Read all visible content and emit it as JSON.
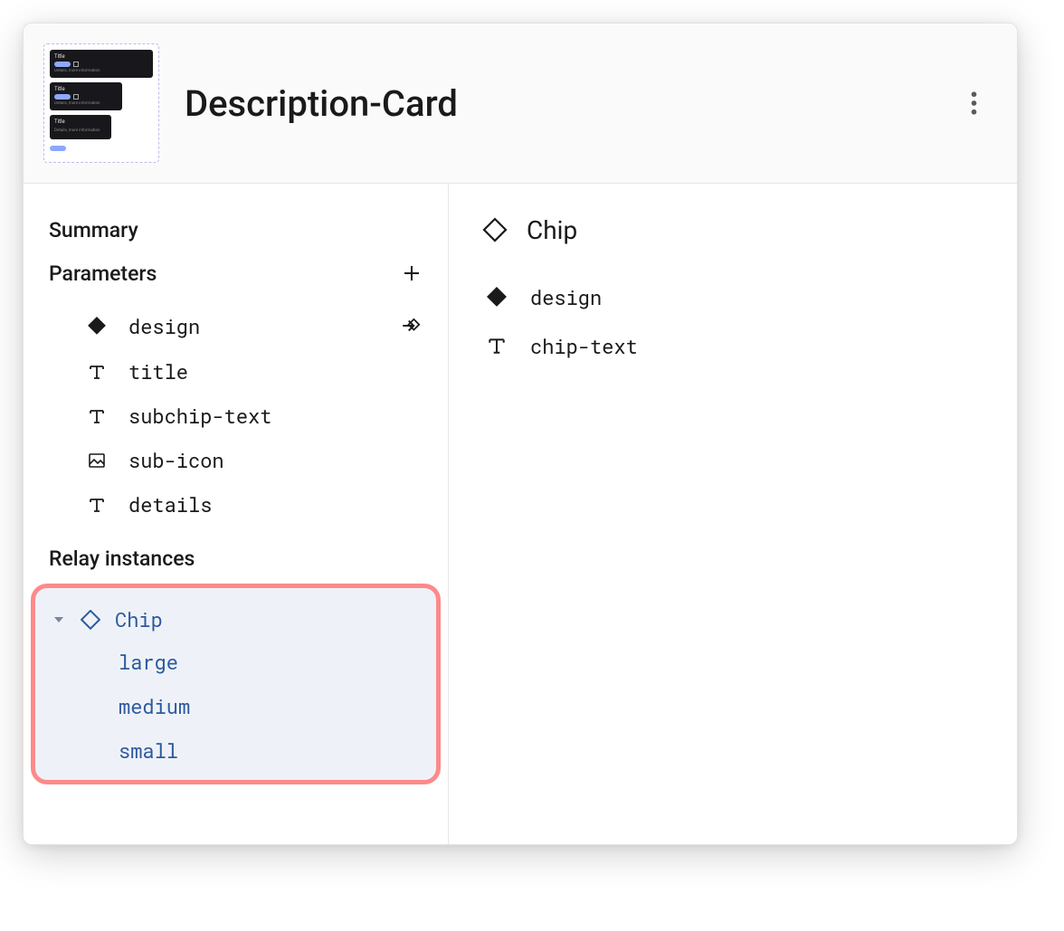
{
  "header": {
    "title": "Description-Card"
  },
  "left": {
    "summary_label": "Summary",
    "parameters_label": "Parameters",
    "parameters": [
      {
        "icon": "instance",
        "name": "design",
        "action": "swap"
      },
      {
        "icon": "text",
        "name": "title"
      },
      {
        "icon": "text",
        "name": "subchip-text"
      },
      {
        "icon": "image",
        "name": "sub-icon"
      },
      {
        "icon": "text",
        "name": "details"
      }
    ],
    "relay_label": "Relay instances",
    "relay": {
      "name": "Chip",
      "variants": [
        "large",
        "medium",
        "small"
      ]
    }
  },
  "right": {
    "title": "Chip",
    "properties": [
      {
        "icon": "instance-solid",
        "name": "design"
      },
      {
        "icon": "text",
        "name": "chip-text"
      }
    ]
  }
}
